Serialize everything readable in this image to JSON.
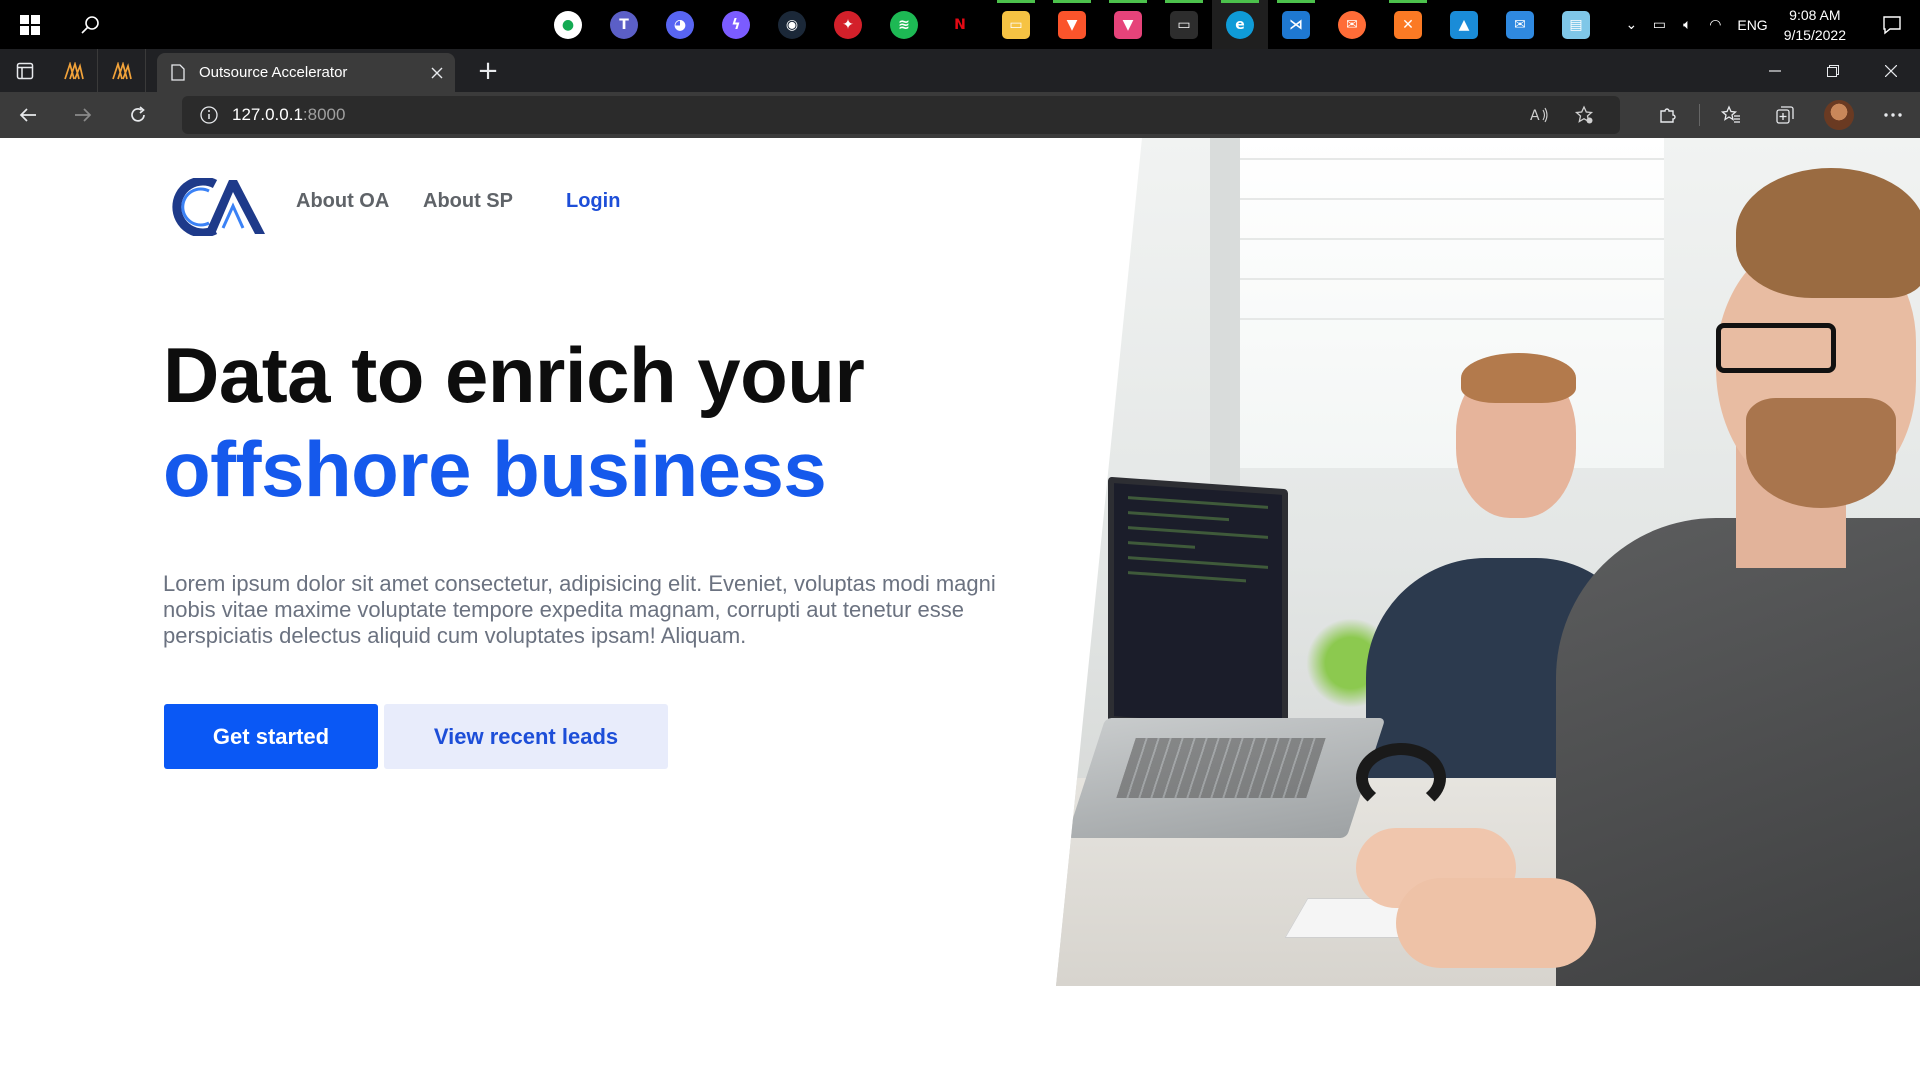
{
  "taskbar": {
    "apps": [
      {
        "name": "mongodb-compass",
        "color": "#ffffff",
        "glyph": "●",
        "running": false
      },
      {
        "name": "teams",
        "color": "#5b5fc7",
        "glyph": "T",
        "running": false
      },
      {
        "name": "discord",
        "color": "#5865f2",
        "glyph": "◕",
        "running": false
      },
      {
        "name": "messenger",
        "color": "#7b5cff",
        "glyph": "ϟ",
        "running": false
      },
      {
        "name": "steam",
        "color": "#1b2838",
        "glyph": "◉",
        "running": false
      },
      {
        "name": "garena",
        "color": "#d3202a",
        "glyph": "✦",
        "running": false
      },
      {
        "name": "spotify",
        "color": "#1db954",
        "glyph": "≋",
        "running": false
      },
      {
        "name": "netflix",
        "color": "#000000",
        "glyph": "N",
        "running": false
      },
      {
        "name": "file-explorer",
        "color": "#f6c343",
        "glyph": "▭",
        "running": true
      },
      {
        "name": "brave",
        "color": "#fb542b",
        "glyph": "▼",
        "running": true
      },
      {
        "name": "brave-beta",
        "color": "#e6437a",
        "glyph": "▼",
        "running": true
      },
      {
        "name": "terminal",
        "color": "#2d2d2d",
        "glyph": "▭",
        "running": true
      },
      {
        "name": "edge",
        "color": "#0f9bd7",
        "glyph": "e",
        "running": true
      },
      {
        "name": "vscode",
        "color": "#1e78d1",
        "glyph": "⋊",
        "running": true
      },
      {
        "name": "postman",
        "color": "#ff6c37",
        "glyph": "✉",
        "running": false
      },
      {
        "name": "xampp",
        "color": "#fb7a24",
        "glyph": "✕",
        "running": true
      },
      {
        "name": "photos",
        "color": "#1a8cd8",
        "glyph": "▲",
        "running": false
      },
      {
        "name": "mail",
        "color": "#2f89e0",
        "glyph": "✉",
        "running": false
      },
      {
        "name": "notepad",
        "color": "#7fc7e8",
        "glyph": "▤",
        "running": false
      }
    ],
    "tray_lang": "ENG",
    "time": "9:08 AM",
    "date": "9/15/2022"
  },
  "browser": {
    "tab_title": "Outsource Accelerator",
    "url_host": "127.0.0.1",
    "url_port": ":8000"
  },
  "page": {
    "nav": {
      "about_oa": "About OA",
      "about_sp": "About SP",
      "login": "Login"
    },
    "headline_line1": "Data to enrich your",
    "headline_line2": "offshore business",
    "lead": "Lorem ipsum dolor sit amet consectetur, adipisicing elit. Eveniet, voluptas modi magni nobis vitae maxime voluptate tempore expedita magnam, corrupti aut tenetur esse perspiciatis delectus aliquid cum voluptates ipsam! Aliquam.",
    "cta_primary": "Get started",
    "cta_secondary": "View recent leads"
  },
  "colors": {
    "brand_blue": "#1559ec",
    "primary_button": "#0a58f5",
    "secondary_button_bg": "#e8ecfb",
    "logo_navy": "#1e3a8a"
  }
}
